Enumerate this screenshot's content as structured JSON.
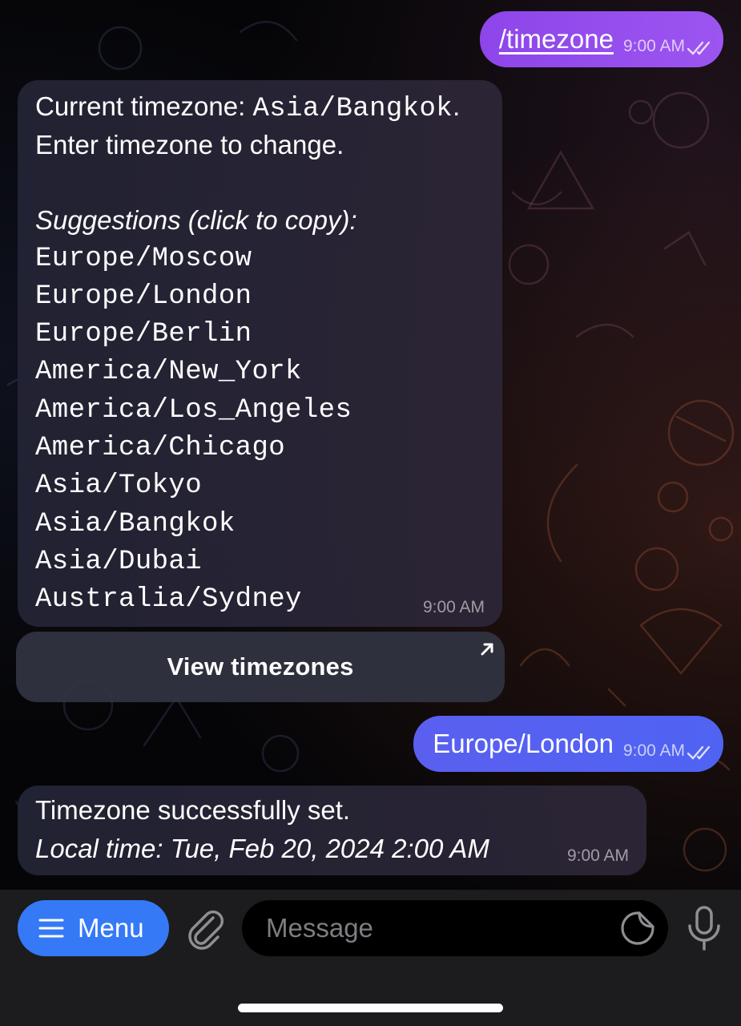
{
  "messages": {
    "outgoing_1": {
      "text": "/timezone",
      "time": "9:00 AM"
    },
    "incoming_1": {
      "line1": "Current timezone: ",
      "current_zone": "Asia/Bangkok",
      "line1_end": ".",
      "line2": "Enter timezone to change.",
      "suggestions_heading": "Suggestions (click to copy):",
      "suggestions": [
        "Europe/Moscow",
        "Europe/London",
        "Europe/Berlin",
        "America/New_York",
        "America/Los_Angeles",
        "America/Chicago",
        "Asia/Tokyo",
        "Asia/Bangkok",
        "Asia/Dubai",
        "Australia/Sydney"
      ],
      "time": "9:00 AM"
    },
    "inline_button": {
      "label": "View timezones",
      "icon": "arrow-up-right-icon"
    },
    "outgoing_2": {
      "text": "Europe/London",
      "time": "9:00 AM"
    },
    "incoming_2": {
      "line1": "Timezone successfully set.",
      "line2": "Local time: Tue, Feb 20, 2024 2:00 AM",
      "time": "9:00 AM"
    }
  },
  "composer": {
    "menu_label": "Menu",
    "placeholder": "Message",
    "icons": [
      "menu-lines-icon",
      "paperclip-icon",
      "sticker-icon",
      "microphone-icon"
    ]
  },
  "colors": {
    "outgoing_1": "#9b51ef",
    "outgoing_2": "#5362f2",
    "menu_button": "#3579f6",
    "incoming_bubble": "#262636"
  }
}
